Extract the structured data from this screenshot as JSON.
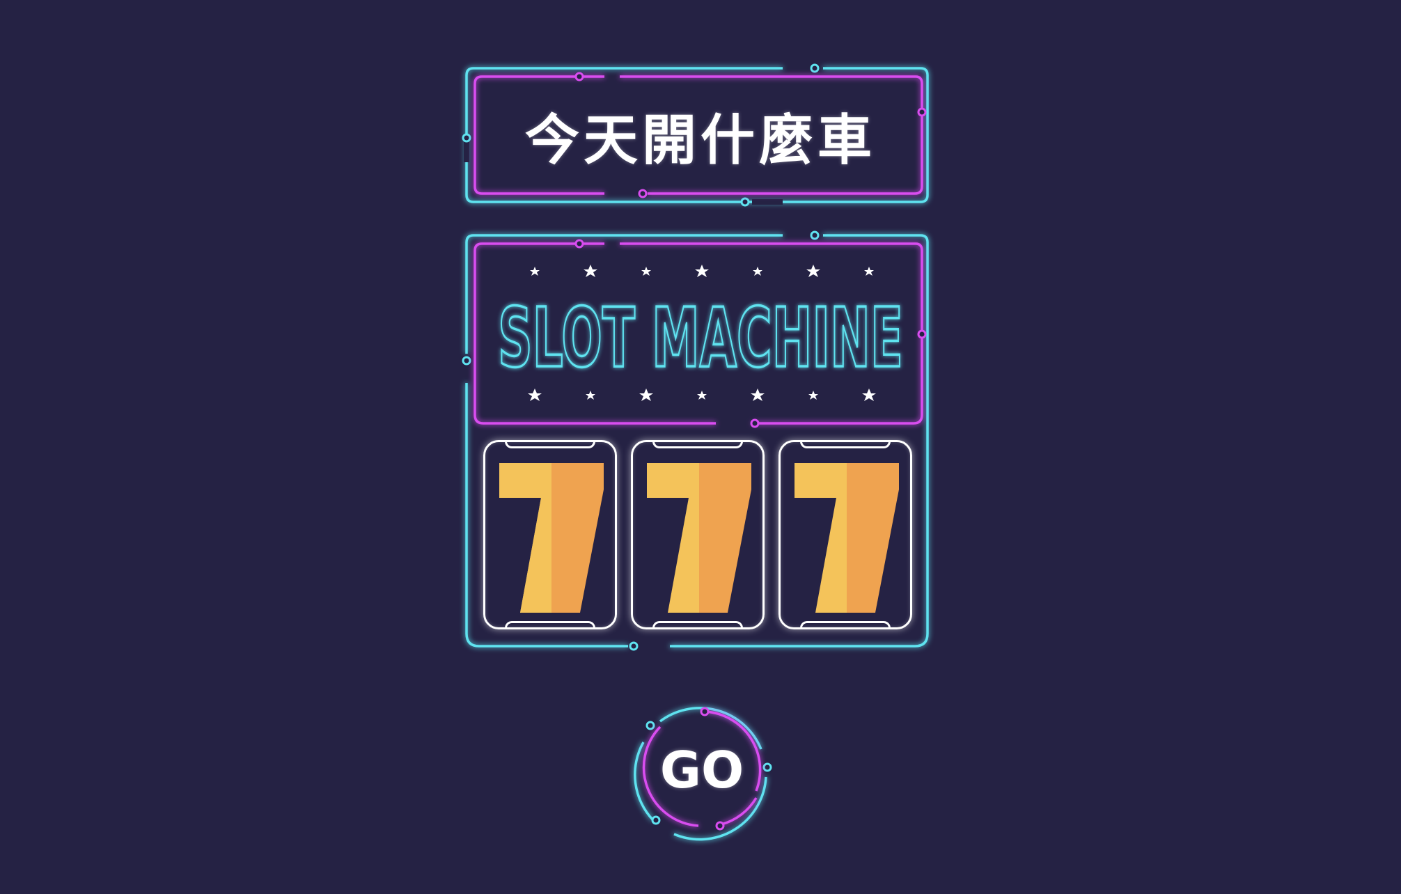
{
  "header": {
    "title": "今天開什麼車"
  },
  "machine": {
    "heading": "SLOT MACHINE",
    "reels": [
      {
        "symbol": "7"
      },
      {
        "symbol": "7"
      },
      {
        "symbol": "7"
      }
    ]
  },
  "controls": {
    "go_label": "GO"
  },
  "colors": {
    "background": "#252244",
    "neon_cyan": "#5FE3F0",
    "neon_magenta": "#D94DF0",
    "seven_light": "#F4C35A",
    "seven_dark": "#EFA350",
    "reel_border": "#FFFFFF"
  }
}
